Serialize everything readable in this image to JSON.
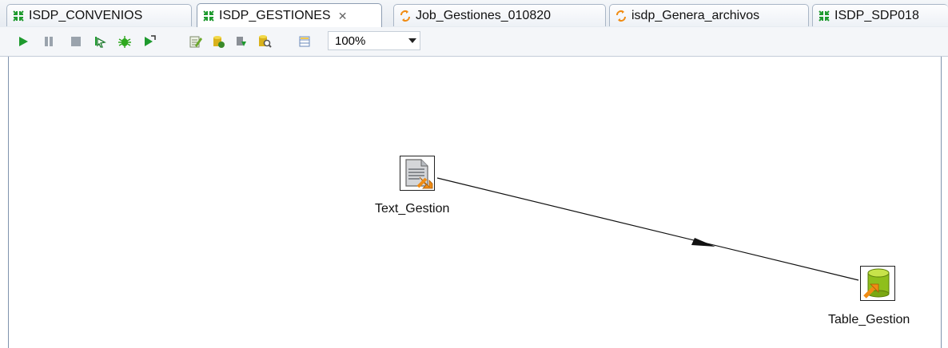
{
  "tabs": [
    {
      "label": "ISDP_CONVENIOS",
      "icon": "job-green-arrows-icon",
      "active": false
    },
    {
      "label": "ISDP_GESTIONES",
      "icon": "job-green-arrows-icon",
      "active": true,
      "close": "✕"
    },
    {
      "label": "Job_Gestiones_010820",
      "icon": "job-orange-cycle-icon",
      "active": false
    },
    {
      "label": "isdp_Genera_archivos",
      "icon": "job-orange-cycle-icon",
      "active": false
    },
    {
      "label": "ISDP_SDP018",
      "icon": "job-green-arrows-icon",
      "active": false
    }
  ],
  "toolbar": {
    "buttons": [
      "run-icon",
      "pause-icon",
      "stop-icon",
      "step-icon",
      "debug-icon",
      "run-export-icon",
      "edit-properties-icon",
      "database-build-icon",
      "deploy-icon",
      "inspect-icon",
      "grid-view-icon"
    ],
    "zoom": "100%"
  },
  "canvas": {
    "nodes": [
      {
        "label": "Text_Gestion",
        "icon": "text-file-input-icon"
      },
      {
        "label": "Table_Gestion",
        "icon": "database-table-output-icon"
      }
    ]
  },
  "colors": {
    "run_green": "#1e9a2e",
    "orange_arrow": "#f08c14",
    "db_green": "#8fbf1c"
  }
}
